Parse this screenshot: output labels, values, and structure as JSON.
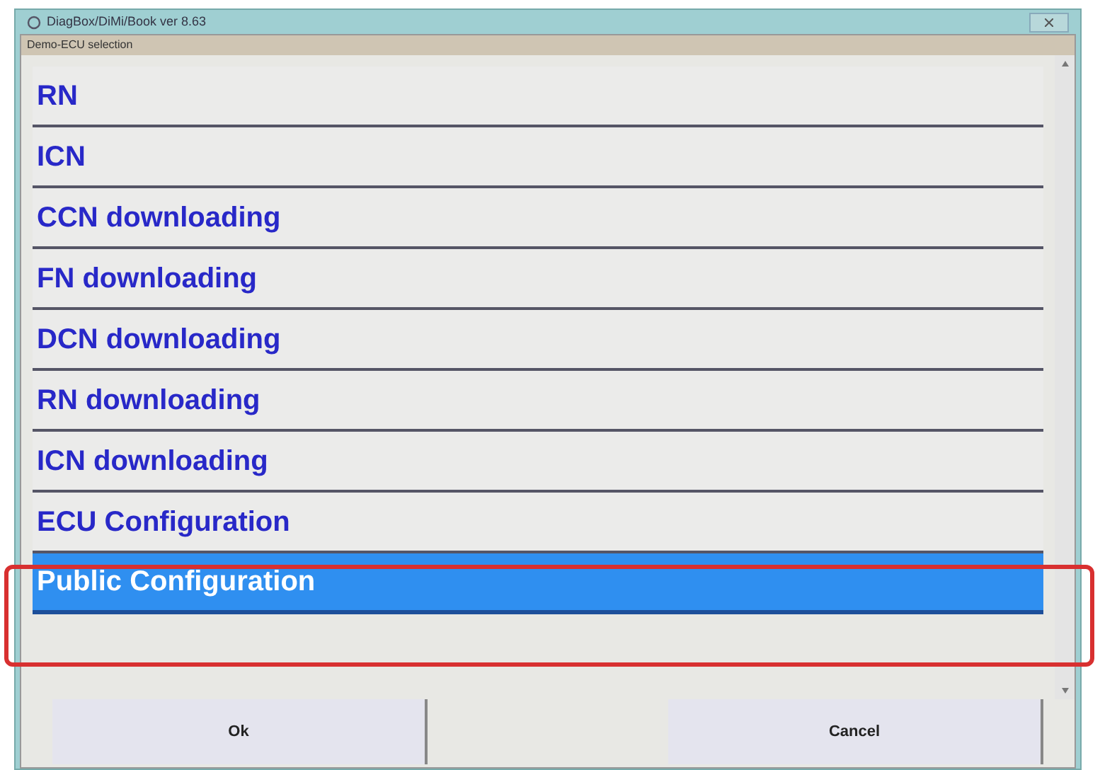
{
  "window": {
    "title": "DiagBox/DiMi/Book ver 8.63",
    "subtitle": "Demo-ECU selection"
  },
  "items": [
    {
      "label": "RN",
      "selected": false
    },
    {
      "label": "ICN",
      "selected": false
    },
    {
      "label": "CCN downloading",
      "selected": false
    },
    {
      "label": "FN downloading",
      "selected": false
    },
    {
      "label": "DCN downloading",
      "selected": false
    },
    {
      "label": "RN downloading",
      "selected": false
    },
    {
      "label": "ICN downloading",
      "selected": false
    },
    {
      "label": "ECU Configuration",
      "selected": false
    },
    {
      "label": "Public Configuration",
      "selected": true
    }
  ],
  "buttons": [
    "Ok",
    "Cancel"
  ]
}
